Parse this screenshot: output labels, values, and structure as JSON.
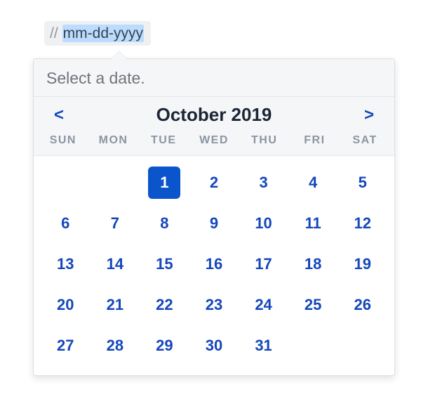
{
  "input": {
    "slashes": "//",
    "placeholder": "mm-dd-yyyy"
  },
  "popover": {
    "prompt": "Select a date."
  },
  "calendar": {
    "prev_label": "<",
    "next_label": ">",
    "month_title": "October 2019",
    "dow": [
      "SUN",
      "MON",
      "TUE",
      "WED",
      "THU",
      "FRI",
      "SAT"
    ],
    "leading_blanks": 2,
    "days_in_month": 31,
    "selected_day": 1
  }
}
